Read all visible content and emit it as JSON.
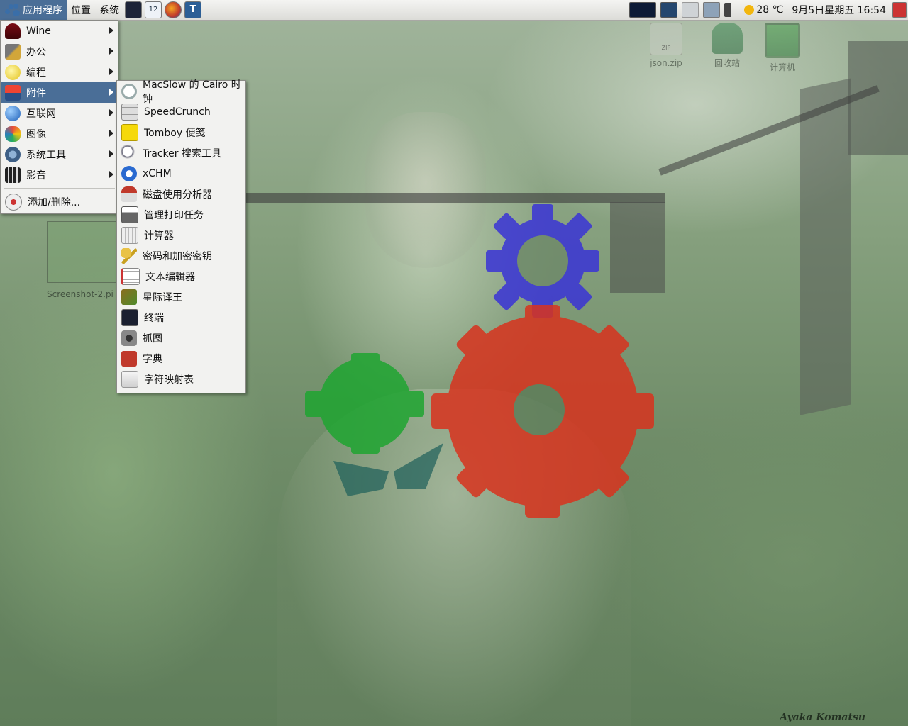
{
  "panel": {
    "menus": [
      "应用程序",
      "位置",
      "系统"
    ],
    "calendar_day": "12",
    "weather": "28 ℃",
    "clock": "9月5日星期五 16:54"
  },
  "desktop": {
    "icons": [
      "json.zip",
      "回收站",
      "计算机"
    ],
    "zip_label": "ZIP",
    "thumbnail_label": "Screenshot-2.pi",
    "watermark": "Ayaka Komatsu"
  },
  "apps_menu": {
    "items": [
      {
        "label": "Wine",
        "icon": "wine-icon"
      },
      {
        "label": "办公",
        "icon": "office-icon"
      },
      {
        "label": "编程",
        "icon": "programming-icon"
      },
      {
        "label": "附件",
        "icon": "accessories-icon",
        "selected": true
      },
      {
        "label": "互联网",
        "icon": "internet-icon"
      },
      {
        "label": "图像",
        "icon": "graphics-icon"
      },
      {
        "label": "系统工具",
        "icon": "system-tools-icon"
      },
      {
        "label": "影音",
        "icon": "multimedia-icon"
      }
    ],
    "add_remove": "添加/删除..."
  },
  "accessories_menu": {
    "items": [
      "MacSlow 的 Cairo 时钟",
      "SpeedCrunch",
      "Tomboy 便笺",
      "Tracker 搜索工具",
      "xCHM",
      "磁盘使用分析器",
      "管理打印任务",
      "计算器",
      "密码和加密密钥",
      "文本编辑器",
      "星际译王",
      "终端",
      "抓图",
      "字典",
      "字符映射表"
    ]
  },
  "colors": {
    "selection": "#4a6e97",
    "gear_blue": "#3a34d6",
    "gear_red": "#d8331e",
    "gear_green": "#1fa531"
  }
}
